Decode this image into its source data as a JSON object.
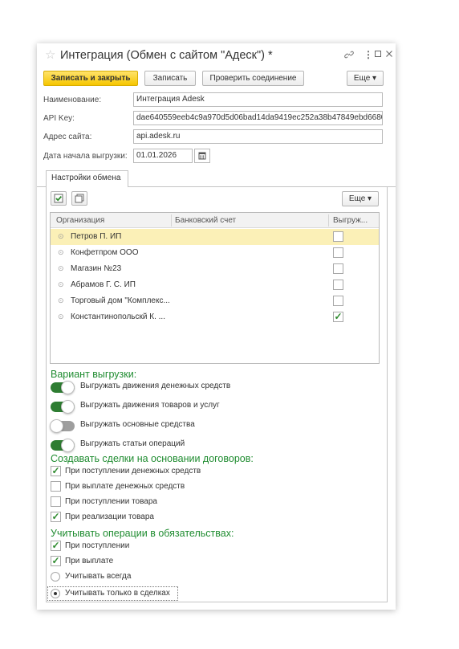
{
  "window": {
    "title": "Интеграция (Обмен с сайтом \"Адеск\") *",
    "icons": {
      "favorite": "star-icon",
      "link": "link-icon",
      "more": "more-vertical-icon",
      "maximize": "maximize-icon",
      "close": "close-icon"
    }
  },
  "toolbar": {
    "save_close": "Записать и закрыть",
    "save": "Записать",
    "check": "Проверить соединение",
    "more": "Еще ▾"
  },
  "fields": {
    "name_label": "Наименование:",
    "name_value": "Интеграция Adesk",
    "api_label": "API Key:",
    "api_value": "dae640559eeb4c9a970d5d06bad14da9419ec252a38b47849ebd6680",
    "site_label": "Адрес сайта:",
    "site_value": "api.adesk.ru",
    "date_label": "Дата начала выгрузки:",
    "date_value": "01.01.2026"
  },
  "tab": {
    "label": "Настройки обмена"
  },
  "table_toolbar": {
    "more": "Еще ▾"
  },
  "table": {
    "columns": [
      "Организация",
      "Банковский счет",
      "Выгруж..."
    ],
    "rows": [
      {
        "org": "Петров П. ИП",
        "account": "",
        "checked": false,
        "selected": true
      },
      {
        "org": "Конфетпром ООО",
        "account": "",
        "checked": false,
        "selected": false
      },
      {
        "org": "Магазин №23",
        "account": "",
        "checked": false,
        "selected": false
      },
      {
        "org": "Абрамов Г. С. ИП",
        "account": "",
        "checked": false,
        "selected": false
      },
      {
        "org": "Торговый дом \"Комплекс...",
        "account": "",
        "checked": false,
        "selected": false
      },
      {
        "org": "Константинопольскй К. ...",
        "account": "",
        "checked": true,
        "selected": false
      }
    ]
  },
  "export_variant": {
    "heading": "Вариант выгрузки:",
    "toggles": [
      {
        "label": "Выгружать движения денежных средств",
        "on": true
      },
      {
        "label": "Выгружать движения товаров и услуг",
        "on": true
      },
      {
        "label": "Выгружать основные средства",
        "on": false
      },
      {
        "label": "Выгружать статьи операций",
        "on": true
      }
    ]
  },
  "deals": {
    "heading": "Создавать сделки на основании договоров:",
    "options": [
      {
        "label": "При поступлении денежных средств",
        "checked": true
      },
      {
        "label": "При выплате денежных средств",
        "checked": false
      },
      {
        "label": "При поступлении товара",
        "checked": false
      },
      {
        "label": "При реализации товара",
        "checked": true
      }
    ]
  },
  "obligations": {
    "heading": "Учитывать операции в обязательствах:",
    "checks": [
      {
        "label": "При поступлении",
        "checked": true
      },
      {
        "label": "При выплате",
        "checked": true
      }
    ],
    "radios": [
      {
        "label": "Учитывать всегда",
        "selected": false
      },
      {
        "label": "Учитывать только в сделках",
        "selected": true
      }
    ]
  },
  "colors": {
    "accent_green": "#1f8c30",
    "primary_button": "#f6c600",
    "selected_row": "#fbf0b7",
    "toggle_on": "#2e7d32"
  }
}
